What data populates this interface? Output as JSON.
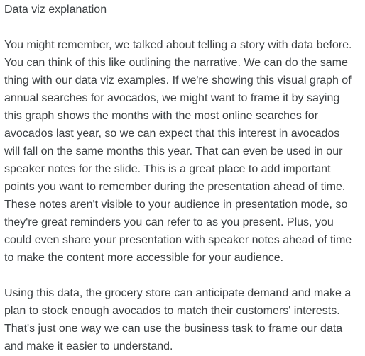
{
  "document": {
    "title": "Data viz explanation",
    "paragraphs": [
      {
        "lines": [
          "You might remember, we talked about telling a story with data before.",
          "You can think of this like outlining the narrative. We can do the same",
          "thing with our data viz examples. If we're showing this visual graph of",
          "annual searches for avocados, we might want to frame it by saying",
          "this graph shows the months with the most online searches for",
          "avocados last year, so we can expect that this interest in avocados",
          "will fall on the same months this year. That can even be used in our",
          "speaker notes for the slide. This is a great place to add important",
          "points you want to remember during the presentation ahead of time.",
          "These notes aren't visible to your audience in presentation mode, so",
          "they're great reminders you can refer to as you present. Plus, you",
          "could even share your presentation with speaker notes ahead of time",
          "to make the content more accessible for your audience."
        ]
      },
      {
        "lines": [
          "Using this data, the grocery store can anticipate demand and make a",
          "plan to stock enough avocados to match their customers' interests.",
          "That's just one way we can use the business task to frame our data",
          "and make it easier to understand."
        ]
      }
    ]
  }
}
